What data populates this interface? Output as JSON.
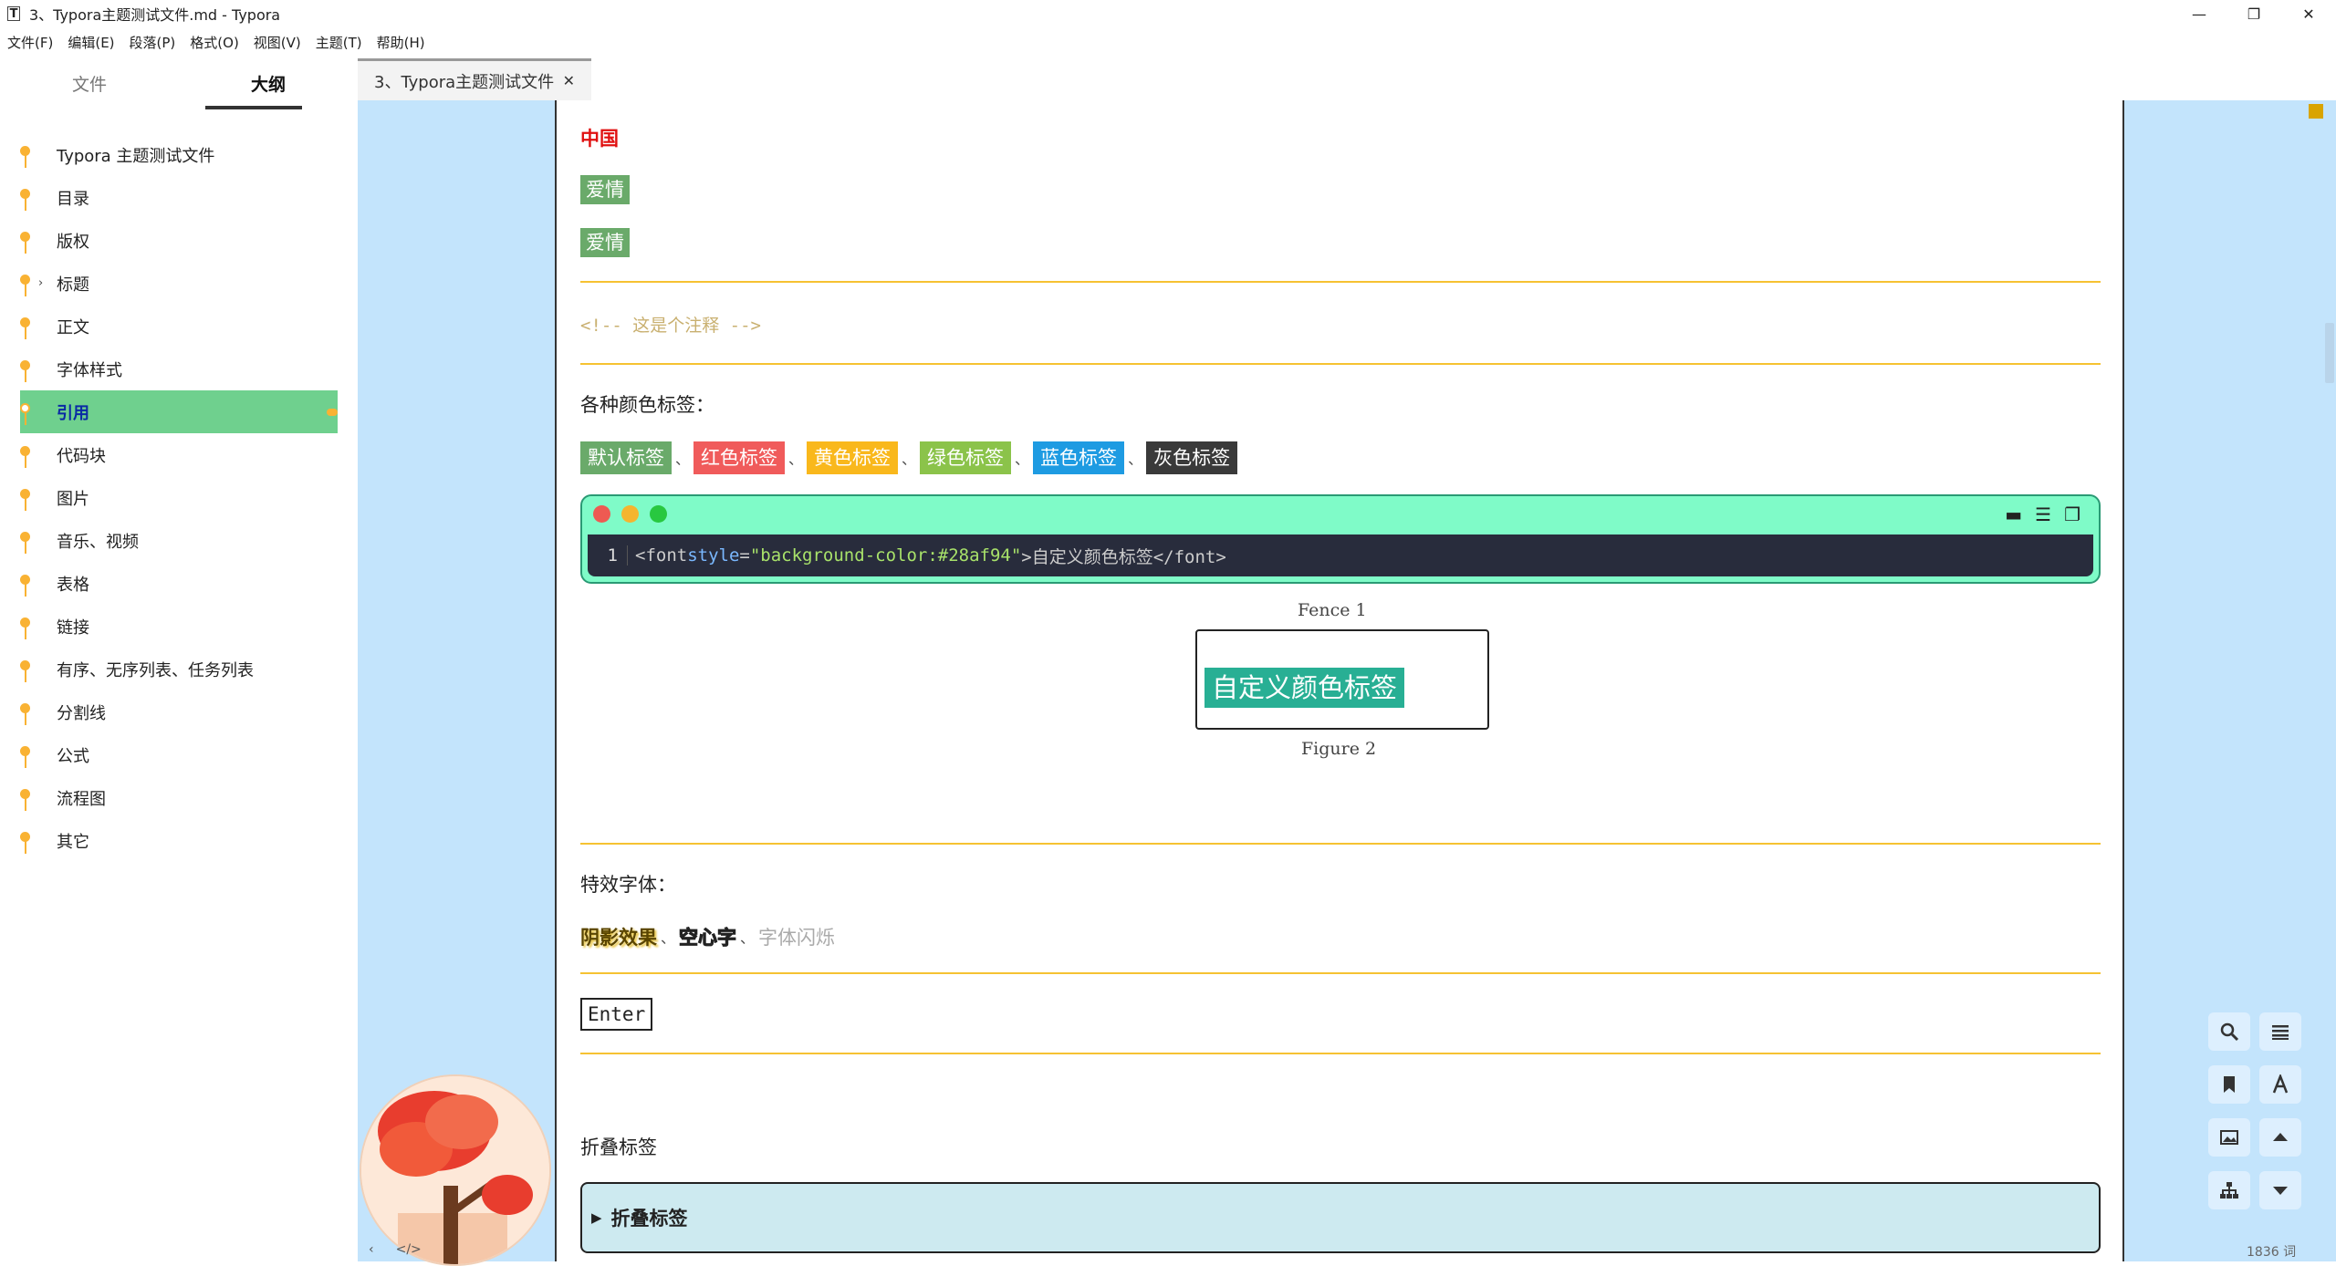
{
  "window": {
    "title": "3、Typora主题测试文件.md - Typora",
    "app_icon": "T",
    "minimize": "—",
    "maximize": "❐",
    "close": "✕"
  },
  "menu": [
    "文件(F)",
    "编辑(E)",
    "段落(P)",
    "格式(O)",
    "视图(V)",
    "主题(T)",
    "帮助(H)"
  ],
  "sidebar": {
    "tab_files": "文件",
    "tab_outline": "大纲",
    "items": [
      {
        "label": "Typora 主题测试文件"
      },
      {
        "label": "目录"
      },
      {
        "label": "版权"
      },
      {
        "label": "标题",
        "collapsed": true
      },
      {
        "label": "正文"
      },
      {
        "label": "字体样式"
      },
      {
        "label": "引用",
        "active": true
      },
      {
        "label": "代码块"
      },
      {
        "label": "图片"
      },
      {
        "label": "音乐、视频"
      },
      {
        "label": "表格"
      },
      {
        "label": "链接"
      },
      {
        "label": "有序、无序列表、任务列表"
      },
      {
        "label": "分割线"
      },
      {
        "label": "公式"
      },
      {
        "label": "流程图"
      },
      {
        "label": "其它"
      }
    ]
  },
  "tab": {
    "label": "3、Typora主题测试文件",
    "close": "✕"
  },
  "doc": {
    "red_text": "中国",
    "green_tag_1": "爱情",
    "green_tag_2": "爱情",
    "comment": "<!-- 这是个注释 -->",
    "color_tags_label": "各种颜色标签：",
    "color_tags": [
      {
        "label": "默认标签",
        "color": "#6aaa6a"
      },
      {
        "label": "红色标签",
        "color": "#f05b5b"
      },
      {
        "label": "黄色标签",
        "color": "#f9b81c"
      },
      {
        "label": "绿色标签",
        "color": "#8bc34a"
      },
      {
        "label": "蓝色标签",
        "color": "#1e9be2"
      },
      {
        "label": "灰色标签",
        "color": "#3a3a3a"
      }
    ],
    "tag_separator": "、",
    "fence": {
      "line_number": "1",
      "code_open": "<font ",
      "code_attr": "style",
      "code_eq": "=",
      "code_str": "\"background-color:#28af94\"",
      "code_rest": ">自定义颜色标签</font>",
      "caption": "Fence 1",
      "dot_colors": [
        "#ee5a52",
        "#f5b52e",
        "#28c840"
      ]
    },
    "figure": {
      "tag": "自定义颜色标签",
      "caption": "Figure 2",
      "tag_color": "#28af94"
    },
    "effects_label": "特效字体：",
    "effect_shadow": "阴影效果",
    "effect_hollow": "空心字",
    "effect_blink": "字体闪烁",
    "kbd": "Enter",
    "details_heading": "折叠标签",
    "details_summary": "折叠标签"
  },
  "bottom": {
    "word_count": "1836 词",
    "back": "‹",
    "source": "</>"
  },
  "colors": {
    "accent": "#f9b233",
    "editor_bg": "#c3e4fc",
    "active_outline": "#6fd08e"
  }
}
